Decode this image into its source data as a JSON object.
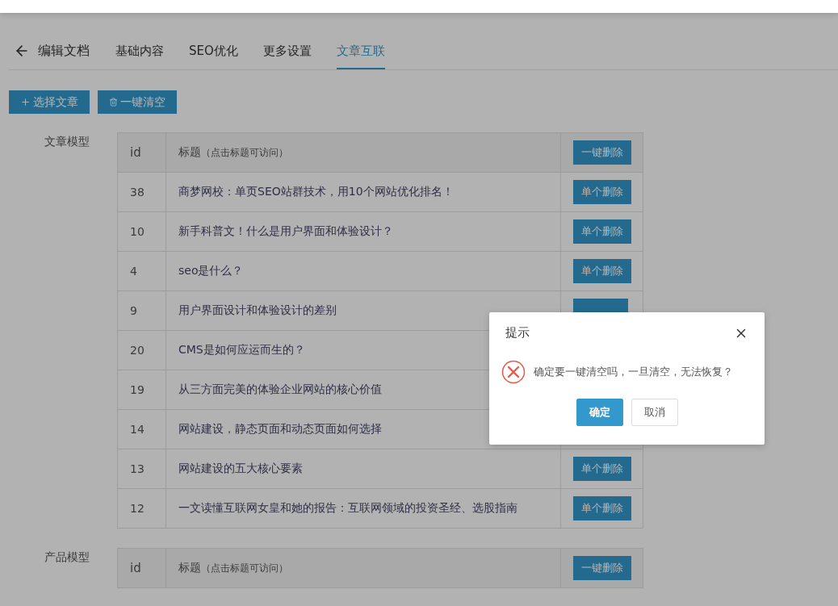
{
  "header": {
    "title": "编辑文档"
  },
  "tabs": [
    {
      "label": "基础内容",
      "selected": false
    },
    {
      "label": "SEO优化",
      "selected": false
    },
    {
      "label": "更多设置",
      "selected": false
    },
    {
      "label": "文章互联",
      "selected": true
    }
  ],
  "toolbar": [
    {
      "kind": "add",
      "label": "选择文章"
    },
    {
      "kind": "clear",
      "label": "一键清空"
    }
  ],
  "sections": [
    {
      "label": "文章模型",
      "columns": {
        "id": "id",
        "title": "标题",
        "title_hint": "（点击标题可访问）",
        "action": "一键删除"
      },
      "rows": [
        {
          "id": "38",
          "title": "商梦网校：单页SEO站群技术，用10个网站优化排名！",
          "action": "单个删除"
        },
        {
          "id": "10",
          "title": "新手科普文！什么是用户界面和体验设计？",
          "action": "单个删除"
        },
        {
          "id": "4",
          "title": "seo是什么？",
          "action": "单个删除"
        },
        {
          "id": "9",
          "title": "用户界面设计和体验设计的差别",
          "covered_button": true
        },
        {
          "id": "20",
          "title": "CMS是如何应运而生的？"
        },
        {
          "id": "19",
          "title": "从三方面完美的体验企业网站的核心价值"
        },
        {
          "id": "14",
          "title": "网站建设，静态页面和动态页面如何选择"
        },
        {
          "id": "13",
          "title": "网站建设的五大核心要素",
          "action": "单个删除"
        },
        {
          "id": "12",
          "title": "一文读懂互联网女皇和她的报告：互联网领域的投资圣经、选股指南",
          "action": "单个删除"
        }
      ]
    },
    {
      "label": "产品模型",
      "columns": {
        "id": "id",
        "title": "标题",
        "title_hint": "（点击标题可访问）",
        "action": "一键删除"
      }
    }
  ],
  "dialog": {
    "title": "提示",
    "message": "确定要一键清空吗，一旦清空，无法恢复？",
    "buttons": [
      {
        "kind": "primary",
        "label": "确定"
      },
      {
        "kind": "default",
        "label": "取消"
      }
    ]
  }
}
